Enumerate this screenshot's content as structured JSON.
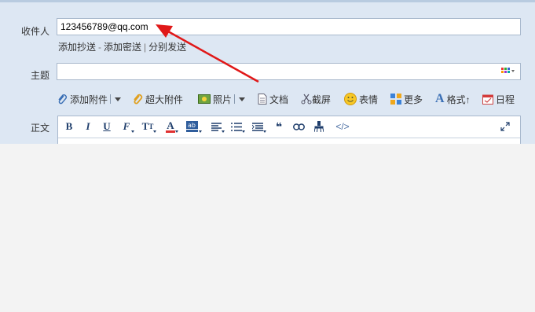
{
  "to": {
    "label": "收件人",
    "value": "123456789@qq.com"
  },
  "recipient_links": {
    "cc": "添加抄送",
    "bcc": "添加密送",
    "separate": "分别发送",
    "dash": "-",
    "bar": "|"
  },
  "subject": {
    "label": "主题",
    "value": ""
  },
  "toolbar": {
    "attach": "添加附件",
    "big_attach": "超大附件",
    "photo": "照片",
    "document": "文档",
    "screenshot": "截屏",
    "emoji": "表情",
    "more": "更多",
    "format": "格式↑",
    "schedule": "日程"
  },
  "body": {
    "label": "正文",
    "html_button": "</>"
  },
  "editor_icons": [
    "bold-icon",
    "italic-icon",
    "underline-icon",
    "font-icon",
    "font-size-icon",
    "font-color-icon",
    "highlight-icon",
    "align-icon",
    "bullet-list-icon",
    "numbered-list-icon",
    "quote-icon",
    "link-icon",
    "clear-format-icon",
    "html-source-icon",
    "fullscreen-icon"
  ],
  "colors": {
    "accent": "#e01818",
    "panel": "#dde7f3",
    "border": "#a8b8cc",
    "icon": "#1e3d6b"
  }
}
